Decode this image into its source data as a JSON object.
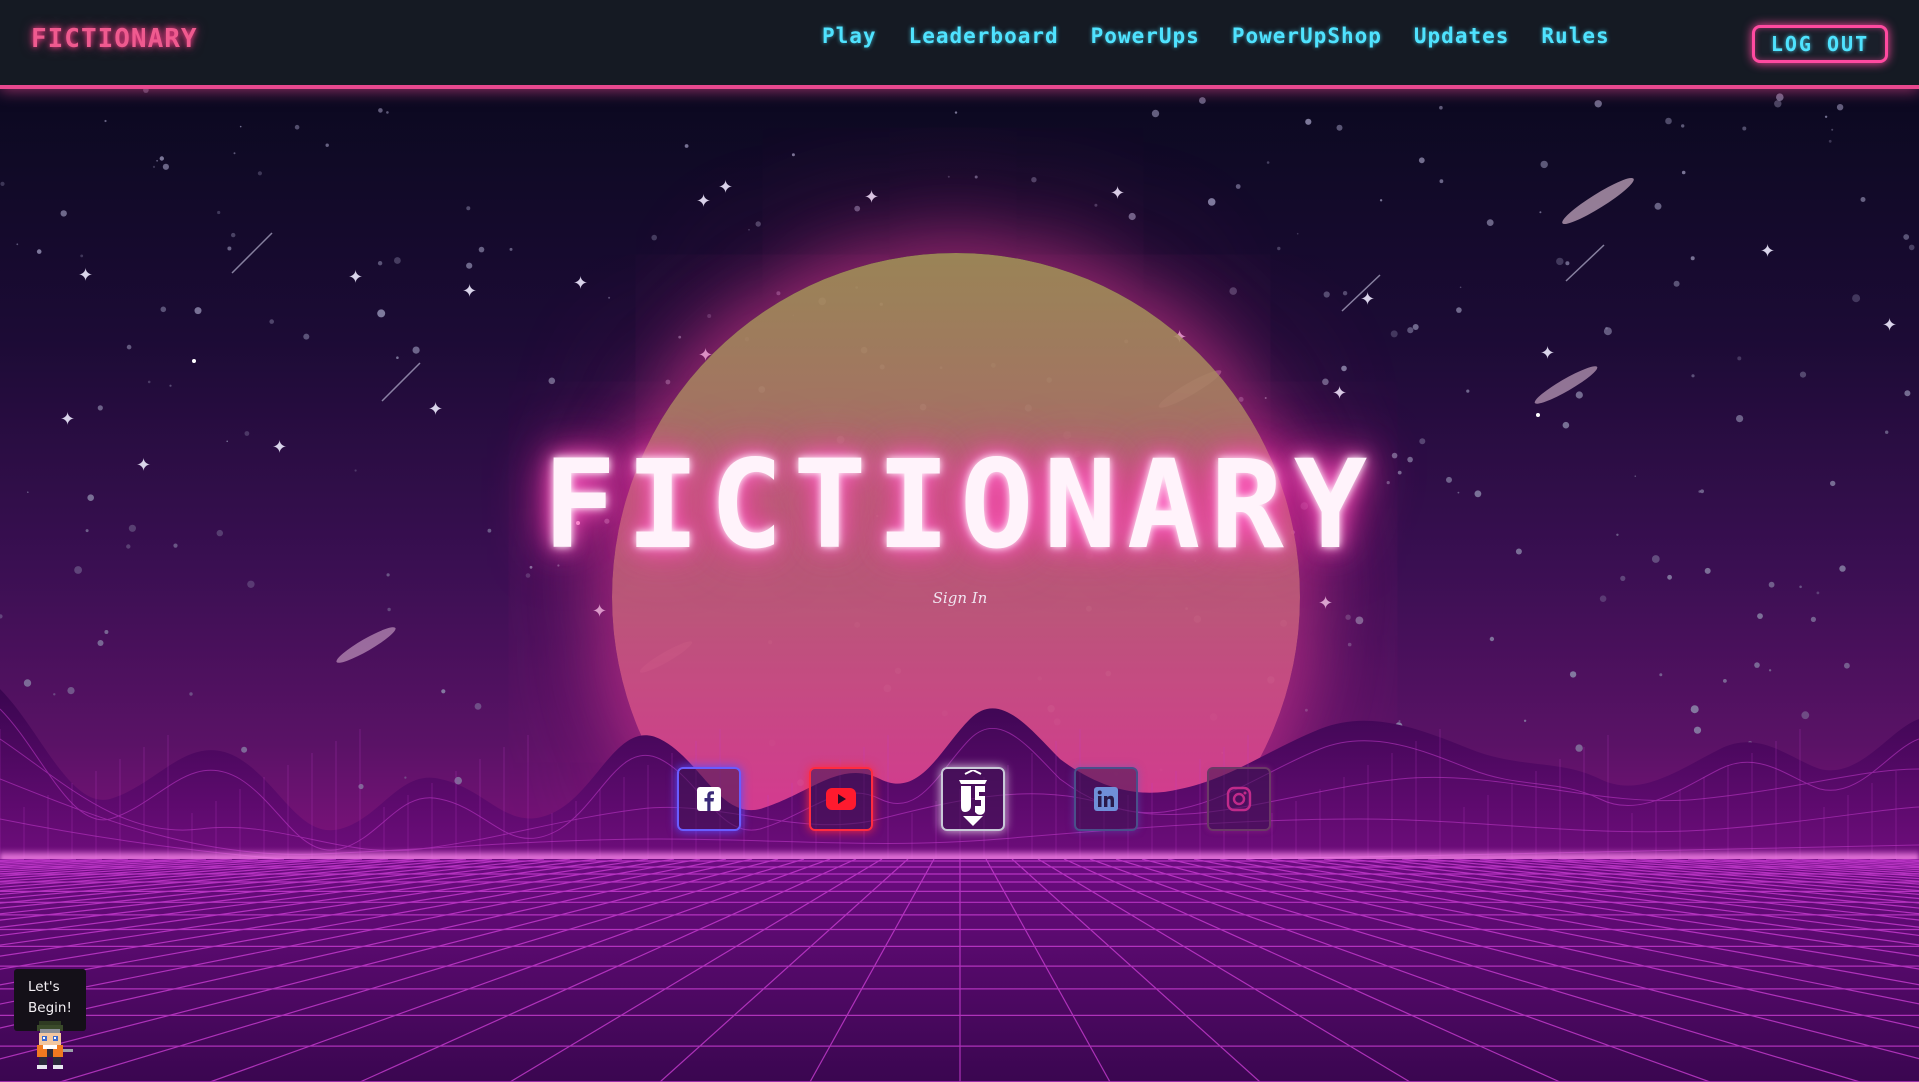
{
  "navbar": {
    "brand": "FICTIONARY",
    "links": [
      "Play",
      "Leaderboard",
      "PowerUps",
      "PowerUpShop",
      "Updates",
      "Rules"
    ],
    "logout_label": "LOG OUT"
  },
  "hero": {
    "title": "FICTIONARY",
    "signin_label": "Sign In"
  },
  "socials": [
    {
      "name": "facebook-icon"
    },
    {
      "name": "youtube-icon"
    },
    {
      "name": "club-logo-icon"
    },
    {
      "name": "linkedin-icon"
    },
    {
      "name": "instagram-icon"
    }
  ],
  "mascot": {
    "bubble_line1": "Let's",
    "bubble_line2": "Begin!"
  },
  "colors": {
    "nav_bg": "#151a23",
    "nav_link": "#4fe3ff",
    "accent_pink": "#ff4aa0",
    "title_glow": "#ff3fb0"
  }
}
